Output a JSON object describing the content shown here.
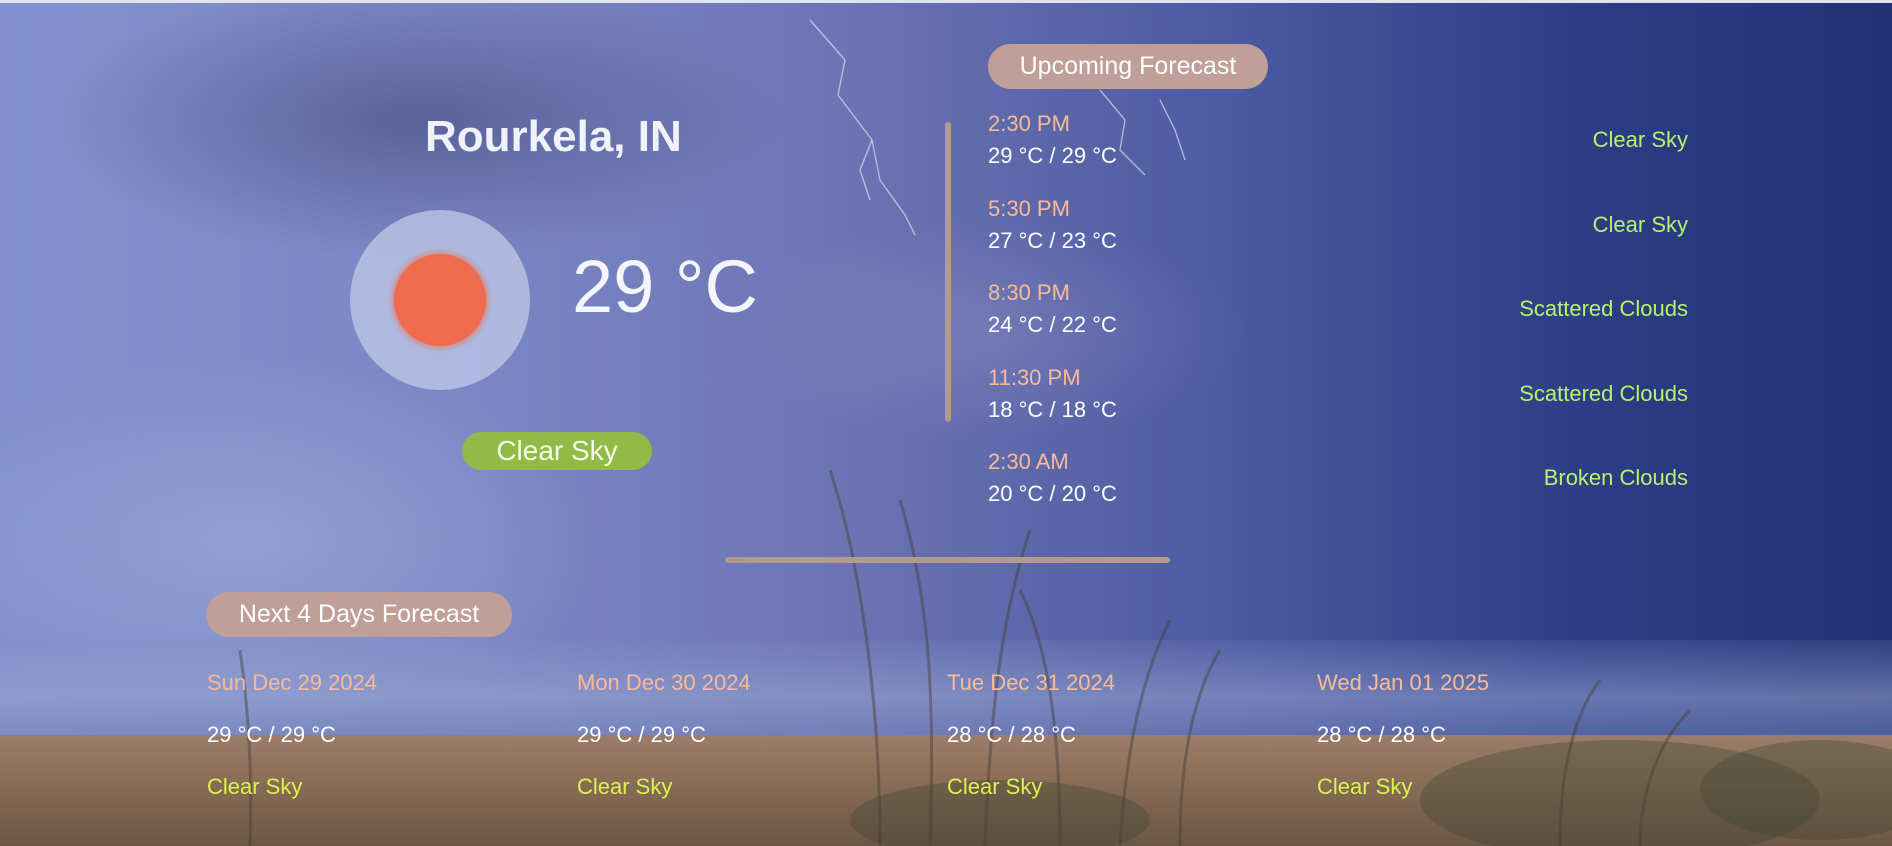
{
  "location": {
    "city": "Rourkela, IN"
  },
  "current": {
    "temperature": "29 °C",
    "condition": "Clear Sky",
    "icon": "sun-icon",
    "icon_color": "#ee6c4d",
    "condition_color": "#8fbb46"
  },
  "upcoming": {
    "title": "Upcoming Forecast",
    "items": [
      {
        "time": "2:30 PM",
        "range": "29 °C / 29 °C",
        "condition": "Clear Sky"
      },
      {
        "time": "5:30 PM",
        "range": "27 °C / 23 °C",
        "condition": "Clear Sky"
      },
      {
        "time": "8:30 PM",
        "range": "24 °C / 22 °C",
        "condition": "Scattered Clouds"
      },
      {
        "time": "11:30 PM",
        "range": "18 °C / 18 °C",
        "condition": "Scattered Clouds"
      },
      {
        "time": "2:30 AM",
        "range": "20 °C / 20 °C",
        "condition": "Broken Clouds"
      }
    ]
  },
  "daily": {
    "title": "Next 4 Days Forecast",
    "items": [
      {
        "date": "Sun Dec 29 2024",
        "range": "29 °C / 29 °C",
        "condition": "Clear Sky"
      },
      {
        "date": "Mon Dec 30 2024",
        "range": "29 °C / 29 °C",
        "condition": "Clear Sky"
      },
      {
        "date": "Tue Dec 31 2024",
        "range": "28 °C / 28 °C",
        "condition": "Clear Sky"
      },
      {
        "date": "Wed Jan 01 2025",
        "range": "28 °C / 28 °C",
        "condition": "Clear Sky"
      }
    ]
  },
  "colors": {
    "accent_pill": "#bf9f97",
    "divider": "#b49a8e",
    "time_text": "#f9ba96",
    "hourly_condition_text": "#b6f36c",
    "daily_condition_text": "#dcf24e"
  }
}
